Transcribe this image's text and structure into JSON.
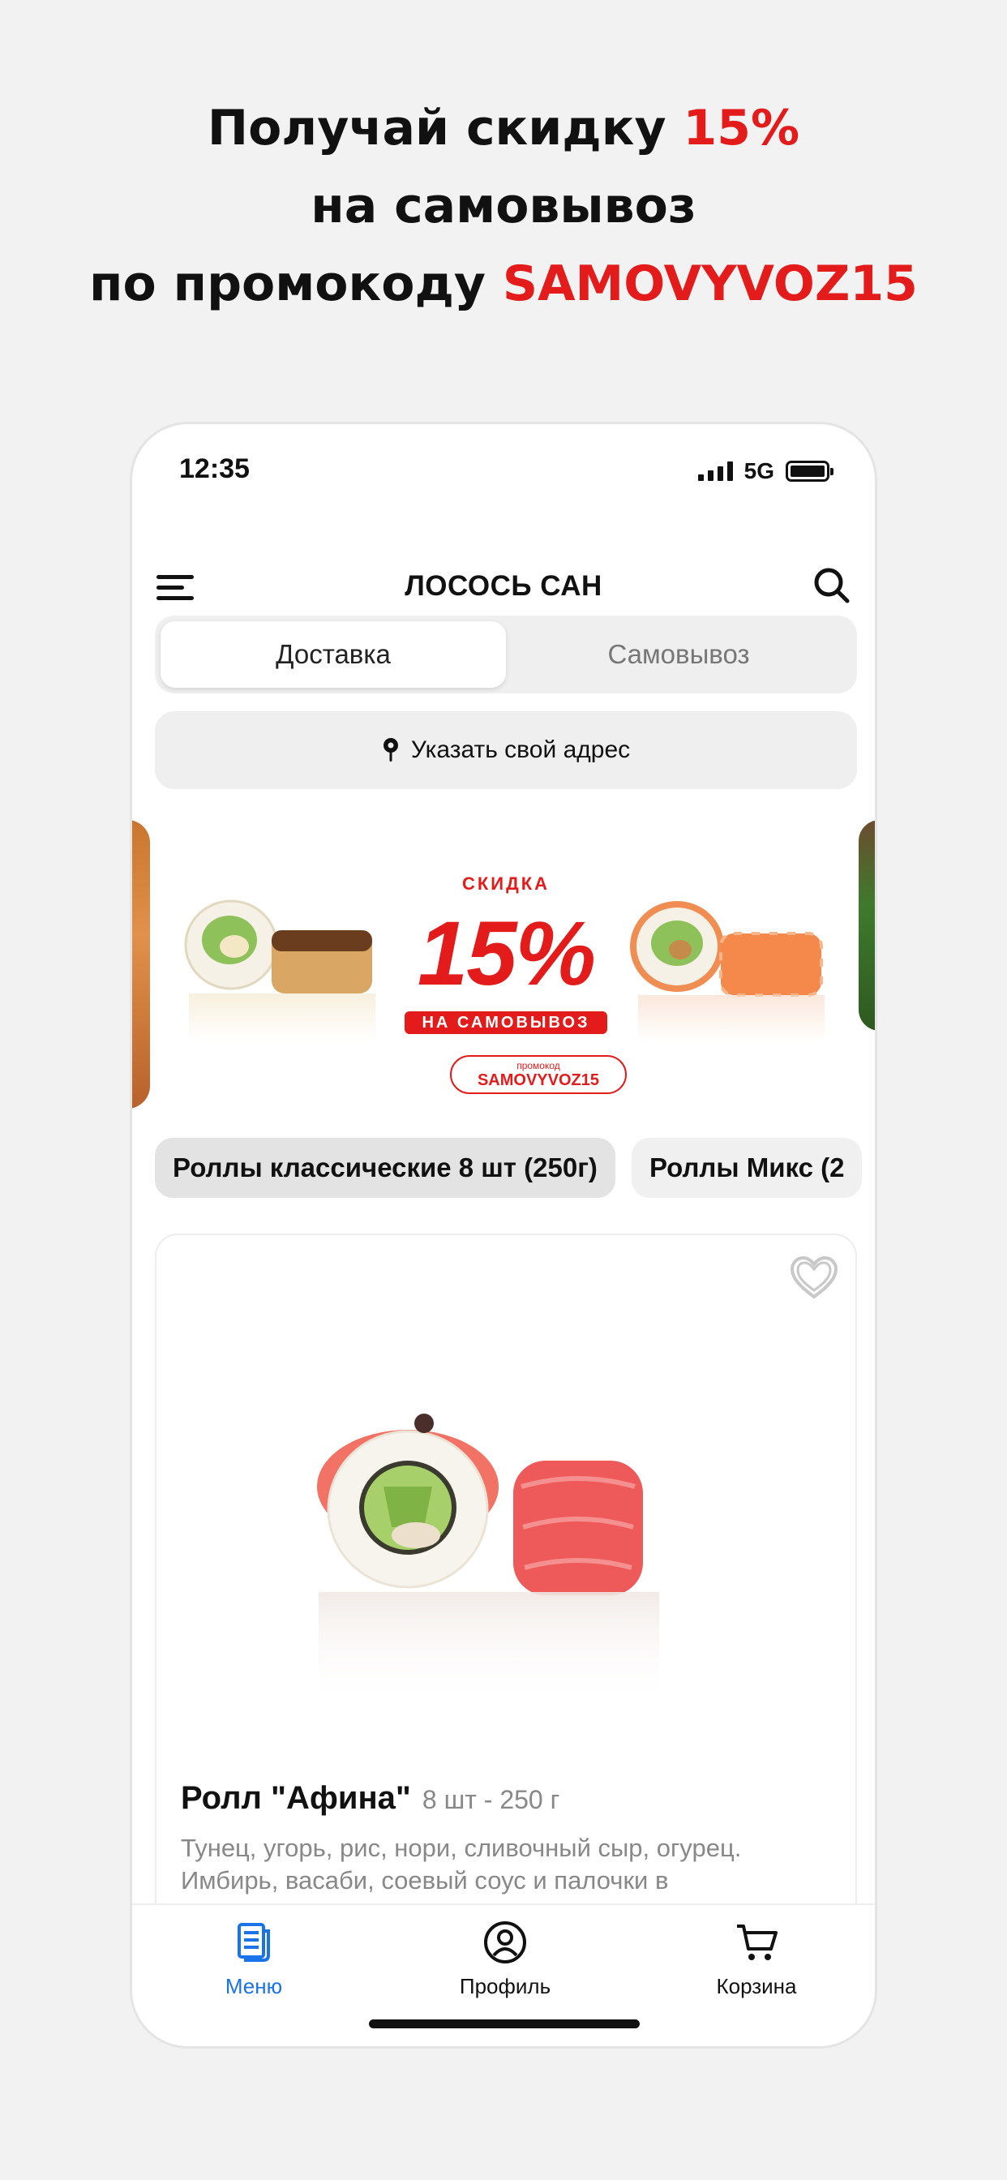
{
  "promo_headline": {
    "line1_prefix": "Получай скидку ",
    "line1_accent": "15%",
    "line2": "на самовывоз",
    "line3_prefix": "по промокоду ",
    "line3_accent": "SAMOVYVOZ15"
  },
  "status_bar": {
    "time": "12:35",
    "network": "5G"
  },
  "app_bar": {
    "title": "ЛОСОСЬ САН"
  },
  "delivery_toggle": {
    "options": [
      "Доставка",
      "Самовывоз"
    ],
    "selected": "Доставка"
  },
  "address": {
    "label": "Указать свой адрес"
  },
  "banner": {
    "top_text": "СКИДКА",
    "discount": "15%",
    "strip_text": "НА САМОВЫВОЗ",
    "promo_label": "промокод",
    "promo_code": "SAMOVYVOZ15"
  },
  "categories": [
    {
      "label": "Роллы классические 8 шт (250г)",
      "active": true
    },
    {
      "label": "Роллы Микс (2",
      "active": false
    }
  ],
  "product": {
    "name": "Ролл \"Афина\"",
    "meta": "8 шт - 250 г",
    "description": "Тунец, угорь, рис, нори, сливочный сыр, огурец. Имбирь, васаби, соевый соус и палочки в"
  },
  "tabs": [
    {
      "label": "Меню",
      "icon": "menu-doc-icon",
      "active": true
    },
    {
      "label": "Профиль",
      "icon": "profile-icon",
      "active": false
    },
    {
      "label": "Корзина",
      "icon": "cart-icon",
      "active": false
    }
  ],
  "colors": {
    "accent_red": "#e31b1b",
    "active_tab_blue": "#1a73e8"
  }
}
